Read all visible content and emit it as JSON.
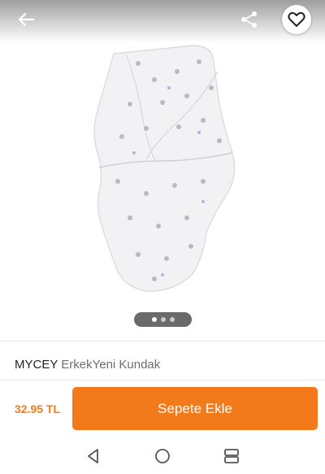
{
  "header": {
    "back_icon": "arrow-left-icon",
    "share_icon": "share-icon",
    "favorite_icon": "heart-outline-icon"
  },
  "gallery": {
    "image_alt": "swaddle blanket product photo",
    "page_count": 3,
    "active_page": 1
  },
  "product": {
    "brand": "MYCEY",
    "name": "ErkekYeni Kundak"
  },
  "purchase": {
    "price": "32.95 TL",
    "cart_button_label": "Sepete Ekle"
  },
  "system_nav": {
    "back_icon": "triangle-back-icon",
    "home_icon": "circle-home-icon",
    "recents_icon": "recents-icon"
  },
  "colors": {
    "accent": "#f27a1a",
    "brand_text": "#222222",
    "name_text": "#6e6e6e"
  }
}
